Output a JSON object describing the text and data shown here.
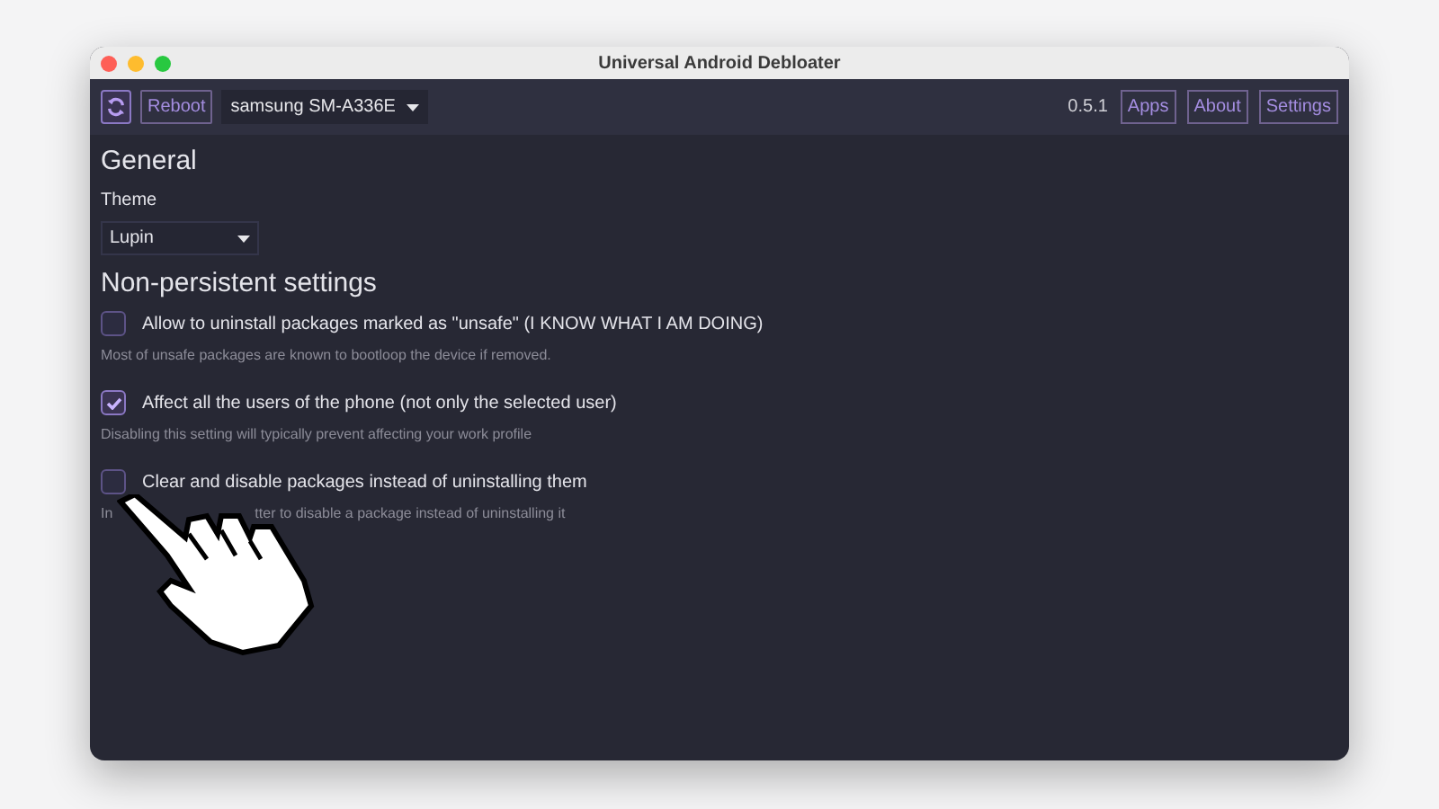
{
  "window": {
    "title": "Universal Android Debloater"
  },
  "toolbar": {
    "reboot": "Reboot",
    "device": "samsung SM-A336E",
    "version": "0.5.1",
    "buttons": [
      "Apps",
      "About",
      "Settings"
    ]
  },
  "general": {
    "heading": "General",
    "theme_label": "Theme",
    "theme_value": "Lupin"
  },
  "non_persistent": {
    "heading": "Non-persistent settings",
    "options": [
      {
        "label": "Allow to uninstall packages marked as \"unsafe\" (I KNOW WHAT I AM DOING)",
        "checked": false,
        "description": [
          "Most of unsafe packages are known to bootloop the device if removed."
        ]
      },
      {
        "label": "Affect all the users of the phone (not only the selected user)",
        "checked": true,
        "description": [
          "Disabling this setting will typically prevent affecting your work profile"
        ]
      },
      {
        "label": "Clear and disable packages instead of uninstalling them",
        "checked": false,
        "description": [
          "In",
          "tter to disable a package instead of uninstalling it"
        ]
      }
    ]
  }
}
